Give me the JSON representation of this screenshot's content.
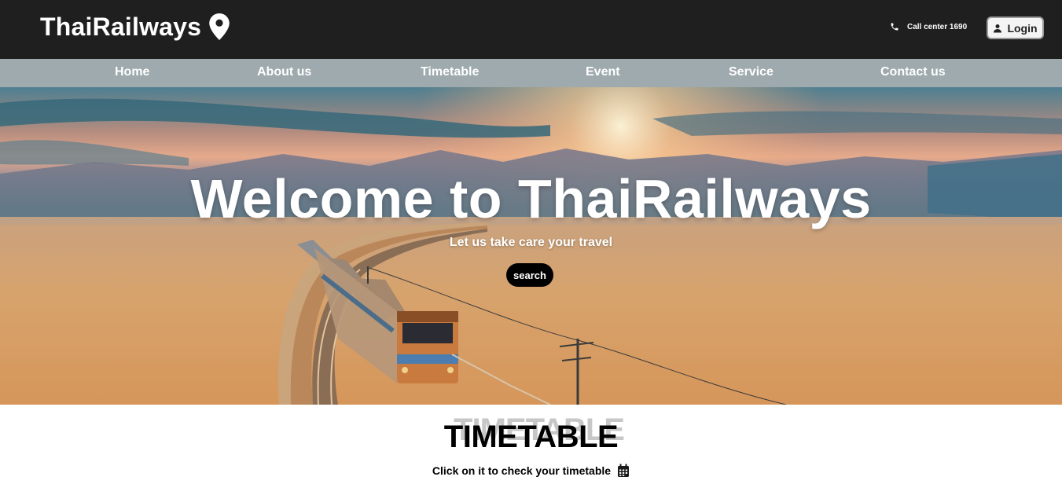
{
  "header": {
    "brand": "ThaiRailways",
    "brand_icon": "map-pin-icon",
    "call_center": "Call center 1690",
    "call_icon": "phone-icon",
    "login_label": "Login",
    "login_icon": "user-icon"
  },
  "nav": {
    "items": [
      {
        "label": "Home"
      },
      {
        "label": "About us"
      },
      {
        "label": "Timetable"
      },
      {
        "label": "Event"
      },
      {
        "label": "Service"
      },
      {
        "label": "Contact us"
      }
    ]
  },
  "hero": {
    "title": "Welcome to ThaiRailways",
    "subtitle": "Let us take care your travel",
    "search_label": "search"
  },
  "timetable": {
    "title_shadow": "TIMETABLE",
    "title": "TIMETABLE",
    "hint": "Click on it to check your timetable",
    "hint_icon": "calendar-icon"
  },
  "colors": {
    "header_bg": "#1f1f1f",
    "nav_bg": "#9eaaad",
    "search_bg": "#000000"
  }
}
